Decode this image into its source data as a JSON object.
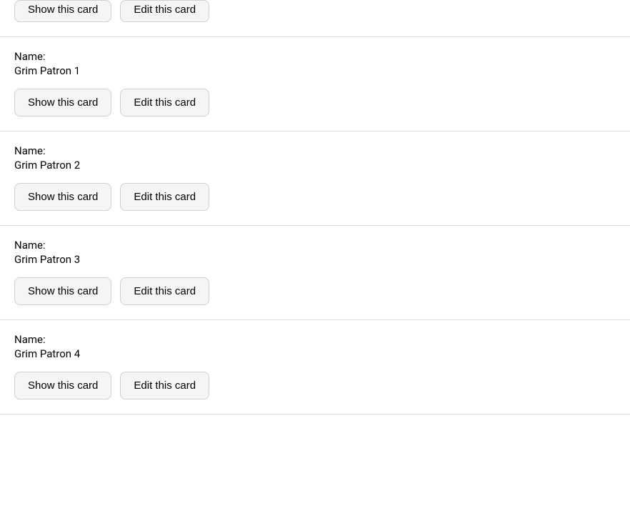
{
  "cards": [
    {
      "id": "partial",
      "name": "",
      "label": "",
      "show_label": "Show this card",
      "edit_label": "Edit this card"
    },
    {
      "id": "card1",
      "label": "Name:",
      "name": "Grim Patron 1",
      "show_label": "Show this card",
      "edit_label": "Edit this card"
    },
    {
      "id": "card2",
      "label": "Name:",
      "name": "Grim Patron 2",
      "show_label": "Show this card",
      "edit_label": "Edit this card"
    },
    {
      "id": "card3",
      "label": "Name:",
      "name": "Grim Patron 3",
      "show_label": "Show this card",
      "edit_label": "Edit this card"
    },
    {
      "id": "card4",
      "label": "Name:",
      "name": "Grim Patron 4",
      "show_label": "Show this card",
      "edit_label": "Edit this card"
    }
  ]
}
